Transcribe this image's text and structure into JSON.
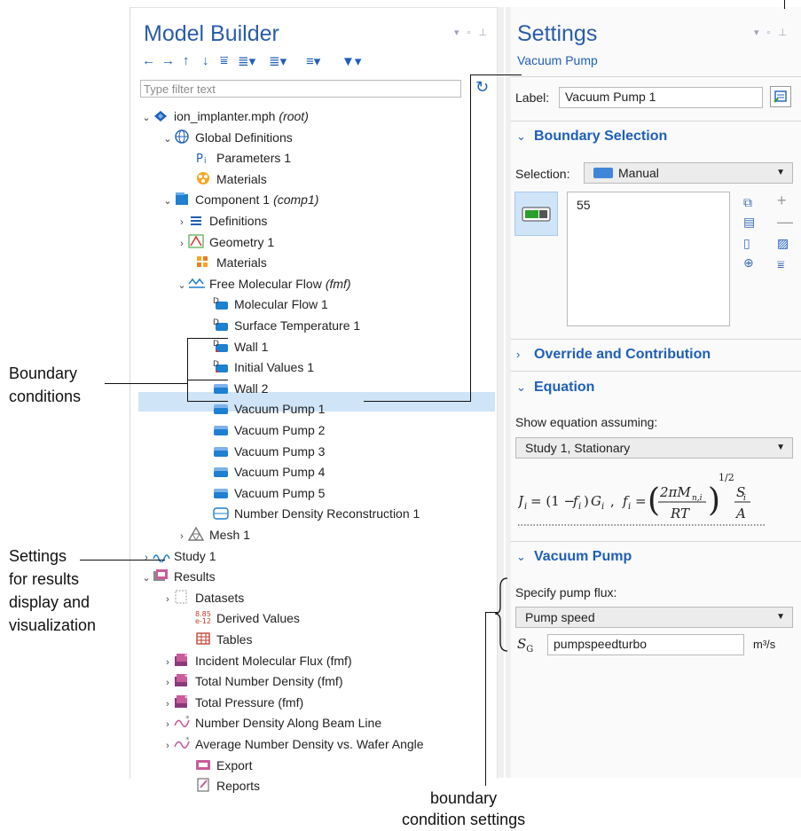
{
  "model_builder": {
    "title": "Model Builder",
    "filter_placeholder": "Type filter text",
    "tree": [
      {
        "label": "ion_implanter.mph",
        "suffix": "(root)"
      },
      {
        "label": "Global Definitions"
      },
      {
        "label": "Parameters 1"
      },
      {
        "label": "Materials"
      },
      {
        "label": "Component 1",
        "suffix": "(comp1)"
      },
      {
        "label": "Definitions"
      },
      {
        "label": "Geometry 1"
      },
      {
        "label": "Materials"
      },
      {
        "label": "Free Molecular Flow",
        "suffix": "(fmf)"
      },
      {
        "label": "Molecular Flow 1"
      },
      {
        "label": "Surface Temperature 1"
      },
      {
        "label": "Wall 1"
      },
      {
        "label": "Initial Values 1"
      },
      {
        "label": "Wall 2"
      },
      {
        "label": "Vacuum Pump 1"
      },
      {
        "label": "Vacuum Pump 2"
      },
      {
        "label": "Vacuum Pump 3"
      },
      {
        "label": "Vacuum Pump 4"
      },
      {
        "label": "Vacuum Pump 5"
      },
      {
        "label": "Number Density Reconstruction 1"
      },
      {
        "label": "Mesh 1"
      },
      {
        "label": "Study 1"
      },
      {
        "label": "Results"
      },
      {
        "label": "Datasets"
      },
      {
        "label": "Derived Values"
      },
      {
        "label": "Tables"
      },
      {
        "label": "Incident Molecular Flux (fmf)"
      },
      {
        "label": "Total Number Density (fmf)"
      },
      {
        "label": "Total Pressure (fmf)"
      },
      {
        "label": "Number Density Along Beam Line"
      },
      {
        "label": "Average Number Density vs. Wafer Angle"
      },
      {
        "label": "Export"
      },
      {
        "label": "Reports"
      }
    ],
    "derived_badge": "8.85\ne-12"
  },
  "settings": {
    "title": "Settings",
    "subtitle": "Vacuum Pump",
    "label_caption": "Label:",
    "label_value": "Vacuum Pump 1",
    "boundary_selection": {
      "header": "Boundary Selection",
      "selection_caption": "Selection:",
      "selection_value": "Manual",
      "list_value": "55"
    },
    "override": {
      "header": "Override and Contribution"
    },
    "equation": {
      "header": "Equation",
      "show_caption": "Show equation assuming:",
      "study_value": "Study 1, Stationary"
    },
    "vacuum_pump": {
      "header": "Vacuum Pump",
      "flux_caption": "Specify pump flux:",
      "flux_value": "Pump speed",
      "sg_symbol": "S",
      "sg_sub": "G",
      "sg_value": "pumpspeedturbo",
      "sg_unit": "m³/s"
    }
  },
  "annotations": {
    "boundary_conditions": "Boundary\nconditions",
    "settings_results": "Settings\nfor results\ndisplay and\nvisualization",
    "bc_settings": "boundary\ncondition settings"
  },
  "colors": {
    "accent": "#1f5fb8",
    "selected_row": "#cfe4f7"
  }
}
